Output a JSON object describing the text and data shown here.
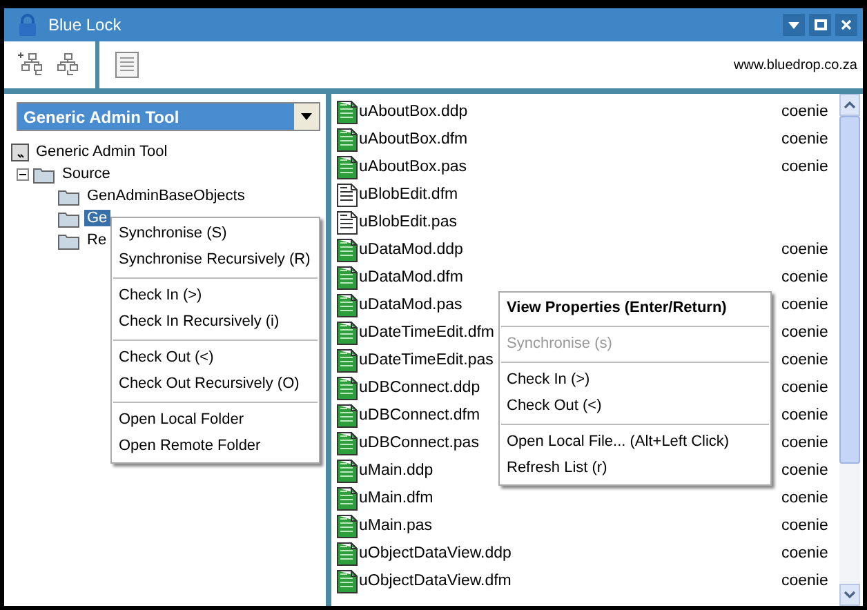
{
  "window": {
    "title": "Blue Lock"
  },
  "toolbar": {
    "link": "www.bluedrop.co.za"
  },
  "project_selector": {
    "value": "Generic Admin Tool"
  },
  "tree": {
    "label": "Generic Admin Tool",
    "children": [
      {
        "label": "Source",
        "expanded": true,
        "selected": false,
        "children": [
          {
            "label": "GenAdminBaseObjects",
            "selected": false
          },
          {
            "label": "Ge",
            "selected": true
          },
          {
            "label": "Re",
            "selected": false
          }
        ]
      }
    ]
  },
  "folder_menu": {
    "groups": [
      [
        "Synchronise (S)",
        "Synchronise Recursively (R)"
      ],
      [
        "Check In (>)",
        "Check In Recursively (i)"
      ],
      [
        "Check Out (<)",
        "Check Out Recursively (O)"
      ],
      [
        "Open Local Folder",
        "Open Remote Folder"
      ]
    ]
  },
  "files": [
    {
      "name": "uAboutBox.ddp",
      "user": "coenie",
      "tracked": true
    },
    {
      "name": "uAboutBox.dfm",
      "user": "coenie",
      "tracked": true
    },
    {
      "name": "uAboutBox.pas",
      "user": "coenie",
      "tracked": true
    },
    {
      "name": "uBlobEdit.dfm",
      "tracked": false
    },
    {
      "name": "uBlobEdit.pas",
      "tracked": false
    },
    {
      "name": "uDataMod.ddp",
      "user": "coenie",
      "tracked": true
    },
    {
      "name": "uDataMod.dfm",
      "user": "coenie",
      "tracked": true
    },
    {
      "name": "uDataMod.pas",
      "user": "coenie",
      "tracked": true
    },
    {
      "name": "uDateTimeEdit.dfm",
      "user": "coenie",
      "tracked": true
    },
    {
      "name": "uDateTimeEdit.pas",
      "user": "coenie",
      "tracked": true
    },
    {
      "name": "uDBConnect.ddp",
      "user": "coenie",
      "tracked": true
    },
    {
      "name": "uDBConnect.dfm",
      "user": "coenie",
      "tracked": true
    },
    {
      "name": "uDBConnect.pas",
      "user": "coenie",
      "tracked": true
    },
    {
      "name": "uMain.ddp",
      "user": "coenie",
      "tracked": true
    },
    {
      "name": "uMain.dfm",
      "user": "coenie",
      "tracked": true
    },
    {
      "name": "uMain.pas",
      "user": "coenie",
      "tracked": true
    },
    {
      "name": "uObjectDataView.ddp",
      "user": "coenie",
      "tracked": true
    },
    {
      "name": "uObjectDataView.dfm",
      "user": "coenie",
      "tracked": true
    }
  ],
  "file_menu": {
    "groups": [
      [
        {
          "label": "View Properties  (Enter/Return)",
          "kind": "default",
          "disabled": false
        }
      ],
      [
        {
          "label": "Synchronise (s)",
          "kind": "normal",
          "disabled": true
        }
      ],
      [
        {
          "label": "Check In  (>)",
          "kind": "normal",
          "disabled": false
        },
        {
          "label": "Check Out  (<)",
          "kind": "normal",
          "disabled": false
        }
      ],
      [
        {
          "label": "Open Local File...  (Alt+Left Click)",
          "kind": "normal",
          "disabled": false
        },
        {
          "label": "Refresh List (r)",
          "kind": "normal",
          "disabled": false
        }
      ]
    ]
  }
}
